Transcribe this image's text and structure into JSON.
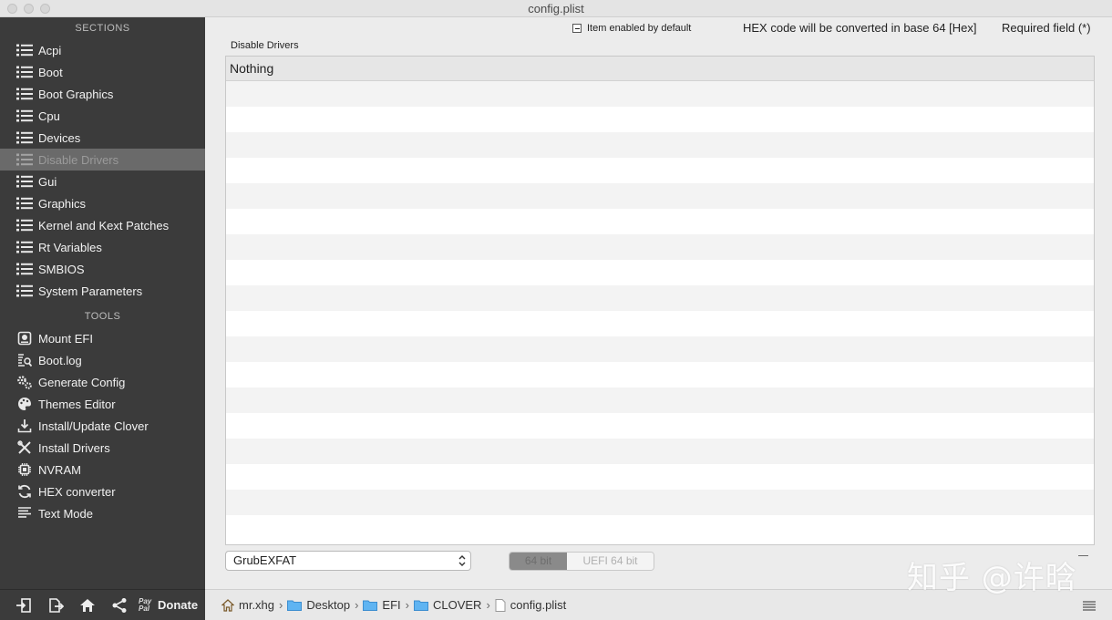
{
  "window": {
    "title": "config.plist"
  },
  "sidebar": {
    "sections_header": "SECTIONS",
    "sections": [
      {
        "label": "Acpi"
      },
      {
        "label": "Boot"
      },
      {
        "label": "Boot Graphics"
      },
      {
        "label": "Cpu"
      },
      {
        "label": "Devices"
      },
      {
        "label": "Disable Drivers",
        "selected": true
      },
      {
        "label": "Gui"
      },
      {
        "label": "Graphics"
      },
      {
        "label": "Kernel and Kext Patches"
      },
      {
        "label": "Rt Variables"
      },
      {
        "label": "SMBIOS"
      },
      {
        "label": "System Parameters"
      }
    ],
    "tools_header": "TOOLS",
    "tools": [
      {
        "label": "Mount EFI",
        "icon": "disk-icon"
      },
      {
        "label": "Boot.log",
        "icon": "log-search-icon"
      },
      {
        "label": "Generate Config",
        "icon": "gears-icon"
      },
      {
        "label": "Themes Editor",
        "icon": "palette-icon"
      },
      {
        "label": "Install/Update Clover",
        "icon": "download-icon"
      },
      {
        "label": "Install Drivers",
        "icon": "wrench-screwdriver-icon"
      },
      {
        "label": "NVRAM",
        "icon": "chip-icon"
      },
      {
        "label": "HEX converter",
        "icon": "refresh-icon"
      },
      {
        "label": "Text Mode",
        "icon": "text-lines-icon"
      }
    ],
    "bottom": {
      "donate_label": "Donate",
      "paypal_text": "Pay Pal"
    }
  },
  "header": {
    "legend_text": "Item enabled by default",
    "hex_note": "HEX code will be converted in base 64 [Hex]",
    "required_note": "Required field (*)"
  },
  "panel": {
    "label": "Disable Drivers",
    "table": {
      "header_cell": "Nothing",
      "empty_rows": 18
    },
    "select": {
      "value": "GrubEXFAT"
    },
    "segmented": {
      "options": [
        "64 bit",
        "UEFI 64 bit"
      ]
    }
  },
  "pathbar": {
    "crumbs": [
      "mr.xhg",
      "Desktop",
      "EFI",
      "CLOVER",
      "config.plist"
    ]
  },
  "watermark": {
    "text": "知乎 @许晗"
  },
  "colors": {
    "sidebar_bg": "#3b3b3b",
    "selected_bg": "#6a6a6a",
    "folder_blue": "#5fb4f2"
  }
}
